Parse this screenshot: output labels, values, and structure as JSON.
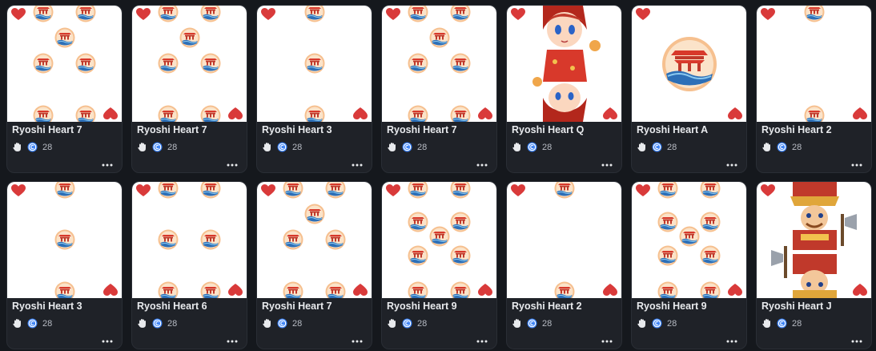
{
  "colors": {
    "page_bg": "#15181d",
    "card_bg": "#1f2228",
    "heart_red": "#d93a3a",
    "title_text": "#e8eaed",
    "meta_text": "#b8bcc4",
    "coin_blue": "#3b82f6"
  },
  "icons": {
    "like": "hand-icon",
    "currency": "coin-icon",
    "menu": "more-options-icon",
    "suit": "heart-icon"
  },
  "cards": [
    {
      "title": "Ryoshi Heart 7",
      "price": "28",
      "rank": "7"
    },
    {
      "title": "Ryoshi Heart 7",
      "price": "28",
      "rank": "7"
    },
    {
      "title": "Ryoshi Heart 3",
      "price": "28",
      "rank": "3"
    },
    {
      "title": "Ryoshi Heart 7",
      "price": "28",
      "rank": "7"
    },
    {
      "title": "Ryoshi Heart Q",
      "price": "28",
      "rank": "Q"
    },
    {
      "title": "Ryoshi Heart A",
      "price": "28",
      "rank": "A"
    },
    {
      "title": "Ryoshi Heart 2",
      "price": "28",
      "rank": "2"
    },
    {
      "title": "Ryoshi Heart 3",
      "price": "28",
      "rank": "3"
    },
    {
      "title": "Ryoshi Heart 6",
      "price": "28",
      "rank": "6"
    },
    {
      "title": "Ryoshi Heart 7",
      "price": "28",
      "rank": "7"
    },
    {
      "title": "Ryoshi Heart 9",
      "price": "28",
      "rank": "9"
    },
    {
      "title": "Ryoshi Heart 2",
      "price": "28",
      "rank": "2"
    },
    {
      "title": "Ryoshi Heart 9",
      "price": "28",
      "rank": "9"
    },
    {
      "title": "Ryoshi Heart J",
      "price": "28",
      "rank": "J"
    }
  ]
}
